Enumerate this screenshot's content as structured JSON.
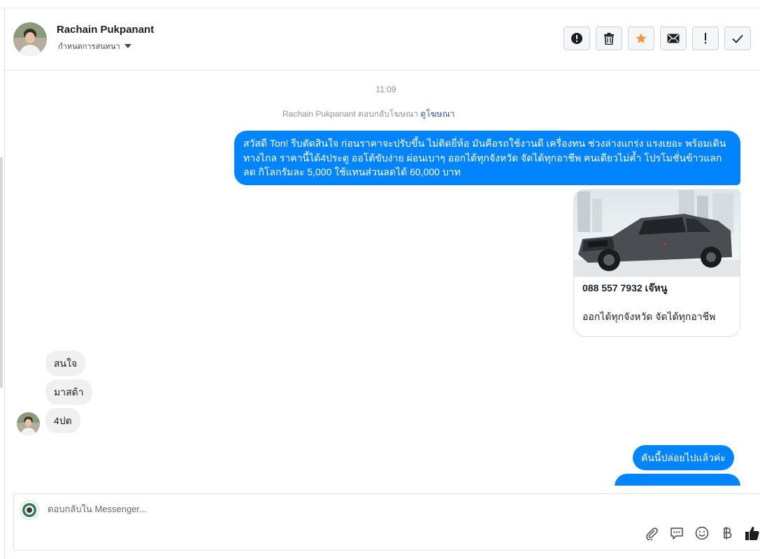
{
  "header": {
    "contact_name": "Rachain Pukpanant",
    "label_dropdown": "กำหนดการสนทนา",
    "toolbar": [
      {
        "name": "alert-button",
        "icon": "alert-circle-icon"
      },
      {
        "name": "delete-button",
        "icon": "trash-icon"
      },
      {
        "name": "star-button",
        "icon": "star-icon",
        "color": "#f7923b"
      },
      {
        "name": "mark-unread-button",
        "icon": "envelope-icon"
      },
      {
        "name": "spam-button",
        "icon": "exclamation-icon"
      },
      {
        "name": "mark-done-button",
        "icon": "check-icon"
      }
    ]
  },
  "conversation": {
    "timestamp": "11:09",
    "ad_reply_prefix": "Rachain Pukpanant ตอบกลับโฆษณา",
    "ad_reply_link": "ดูโฆษณา",
    "messages_out": [
      "สวัสดี Ton! รีบตัดสินใจ ก่อนราคาจะปรับขึ้น ไม่ติดยี่ห้อ มันคือรถใช้งานดี เครื่องทน ช่วงล่างแกร่ง แรงเยอะ พร้อมเดินทางไกล ราคานี้ได้4ประตู ออโต้ขับง่าย ผ่อนเบาๆ ออกได้ทุกจังหวัด จัดได้ทุกอาชีพ คนเดียวไม่ค้ำ โปรโมชั่นข้าวแลกลด กิโลกรัมละ 5,000 ใช้แทนส่วนลดได้ 60,000 บาท",
      "คันนี้ปล่อยไปแล้วค่ะ"
    ],
    "ad_card": {
      "title": "088 557 7932 เจ๊หนู",
      "body": "ออกได้ทุกจังหวัด จัดได้ทุกอาชีพ"
    },
    "messages_in": [
      "สนใจ",
      "มาสด้า",
      "4ปต"
    ],
    "colors": {
      "outgoing": "#0084ff",
      "incoming": "#f1f0f0"
    }
  },
  "composer": {
    "placeholder": "ตอบกลับใน Messenger...",
    "tools": [
      "paperclip-icon",
      "speech-bubble-icon",
      "emoji-icon",
      "baht-icon",
      "like-icon"
    ]
  }
}
